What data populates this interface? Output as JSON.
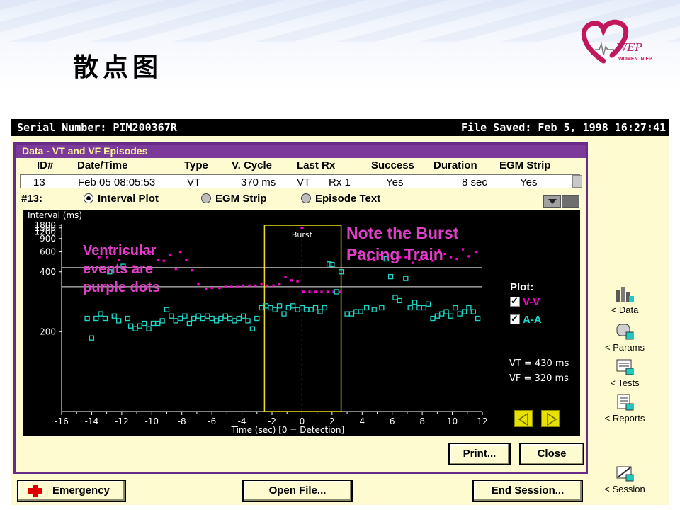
{
  "slide": {
    "title": "散点图"
  },
  "logo": {
    "script": "WEP",
    "caption": "WOMEN IN EP",
    "color": "#c2185b"
  },
  "window": {
    "serial": "Serial Number: PIM200367R",
    "saved": "File Saved: Feb 5, 1998  16:27:41"
  },
  "panel": {
    "title": "Data - VT and VF Episodes",
    "headers": [
      "ID#",
      "Date/Time",
      "Type",
      "V. Cycle",
      "Last Rx",
      "Success",
      "Duration",
      "EGM Strip"
    ],
    "row": [
      "13",
      "Feb 05  08:05:53",
      "VT",
      "370 ms",
      "VT",
      "Rx 1",
      "Yes",
      "8 sec",
      "Yes"
    ],
    "episode_label": "#13:",
    "views": [
      "Interval Plot",
      "EGM Strip",
      "Episode Text"
    ],
    "selected_view": "Interval Plot"
  },
  "plot": {
    "plot_label": "Plot:",
    "series_labels": [
      "V-V",
      "A-A"
    ],
    "thresholds": [
      "VT = 430 ms",
      "VF = 320 ms"
    ],
    "colors": {
      "vv": "#ff00d0",
      "aa": "#20d8c8",
      "burst": "#f0e020"
    }
  },
  "chart_data": {
    "type": "scatter",
    "title": "",
    "xlabel": "Time (sec)   [0 = Detection]",
    "ylabel": "Interval (ms)",
    "xlim": [
      -16,
      12
    ],
    "ylim": [
      120,
      1800
    ],
    "xticks": [
      -16,
      -14,
      -12,
      -10,
      -8,
      -6,
      -4,
      -2,
      0,
      2,
      4,
      6,
      8,
      10,
      12
    ],
    "yticks": [
      1800,
      1500,
      1200,
      900,
      600,
      400,
      200
    ],
    "yscale": "reciprocal",
    "thresholds_ms": [
      430,
      320
    ],
    "burst": {
      "label": "Burst",
      "x_start": -2.5,
      "x_end": 2.6,
      "marker_x": 0,
      "marker_y": 1500
    },
    "series": [
      {
        "name": "V-V",
        "marker": "dot",
        "x": [
          -13.5,
          -13,
          -12.5,
          -12.2,
          -11.7,
          -11.2,
          -10.6,
          -10.1,
          -9.6,
          -9.2,
          -8.8,
          -8.4,
          -8.1,
          -7.7,
          -7.3,
          -6.9,
          -6.4,
          -6.0,
          -5.5,
          -5.1,
          -4.7,
          -4.3,
          -3.9,
          -3.5,
          -3.1,
          -2.7,
          -2.3,
          -1.9,
          -1.5,
          -1.1,
          -0.7,
          -0.3,
          0.1,
          0.5,
          0.9,
          1.3,
          1.7,
          2.1,
          2.5,
          3.1,
          3.5,
          3.9,
          4.4,
          4.8,
          5.2,
          5.6,
          6.1,
          6.5,
          6.9,
          7.4,
          7.8,
          8.2,
          8.7,
          9.1,
          9.5,
          9.9,
          10.3,
          10.7,
          11.1,
          11.6
        ],
        "y": [
          530,
          530,
          600,
          500,
          600,
          440,
          600,
          600,
          500,
          490,
          560,
          420,
          600,
          500,
          410,
          330,
          310,
          315,
          315,
          320,
          320,
          320,
          325,
          325,
          325,
          330,
          325,
          325,
          330,
          370,
          350,
          345,
          300,
          300,
          300,
          300,
          300,
          300,
          300,
          520,
          600,
          610,
          500,
          500,
          560,
          600,
          510,
          530,
          530,
          470,
          500,
          520,
          490,
          630,
          570,
          530,
          510,
          640,
          540,
          600
        ]
      },
      {
        "name": "A-A",
        "marker": "square",
        "x": [
          -14.3,
          -14,
          -13.7,
          -13.4,
          -13.1,
          -12.8,
          -12.5,
          -12.2,
          -11.9,
          -11.6,
          -11.4,
          -11.1,
          -10.8,
          -10.5,
          -10.2,
          -9.9,
          -9.6,
          -9.3,
          -9.0,
          -8.7,
          -8.4,
          -8.1,
          -7.8,
          -7.5,
          -7.2,
          -6.9,
          -6.6,
          -6.3,
          -6.0,
          -5.7,
          -5.4,
          -5.1,
          -4.8,
          -4.5,
          -4.2,
          -3.9,
          -3.6,
          -3.3,
          -3.0,
          -2.7,
          -2.4,
          -2.1,
          -1.8,
          -1.5,
          -1.2,
          -0.9,
          -0.6,
          -0.3,
          0,
          0.3,
          0.6,
          0.9,
          1.2,
          1.5,
          1.8,
          2.0,
          2.3,
          2.6,
          3.0,
          3.3,
          3.6,
          3.9,
          4.3,
          4.8,
          5.3,
          5.6,
          5.9,
          6.2,
          6.5,
          6.9,
          7.2,
          7.5,
          7.8,
          8.1,
          8.4,
          8.7,
          9.0,
          9.3,
          9.6,
          9.9,
          10.2,
          10.5,
          10.8,
          11.1,
          11.4,
          11.7
        ],
        "y": [
          225,
          190,
          225,
          235,
          225,
          400,
          230,
          220,
          440,
          225,
          210,
          205,
          210,
          215,
          205,
          215,
          215,
          220,
          245,
          230,
          220,
          225,
          230,
          215,
          225,
          230,
          225,
          230,
          225,
          220,
          225,
          230,
          225,
          220,
          225,
          230,
          220,
          205,
          225,
          250,
          255,
          250,
          245,
          255,
          235,
          250,
          255,
          245,
          250,
          245,
          245,
          250,
          240,
          250,
          460,
          455,
          300,
          400,
          235,
          235,
          240,
          240,
          250,
          245,
          250,
          510,
          370,
          280,
          270,
          360,
          250,
          265,
          250,
          250,
          260,
          225,
          230,
          235,
          240,
          230,
          250,
          235,
          240,
          250,
          240,
          225
        ]
      }
    ]
  },
  "annotations": {
    "ventricular": "Ventricular\nevents are\npurple dots",
    "burst_note": "Note the Burst\nPacing Train"
  },
  "buttons": {
    "print": "Print...",
    "close": "Close",
    "emergency": "Emergency",
    "open_file": "Open File...",
    "end_session": "End Session..."
  },
  "sidebar": {
    "data": "< Data",
    "params": "< Params",
    "tests": "< Tests",
    "reports": "< Reports",
    "session": "< Session"
  }
}
